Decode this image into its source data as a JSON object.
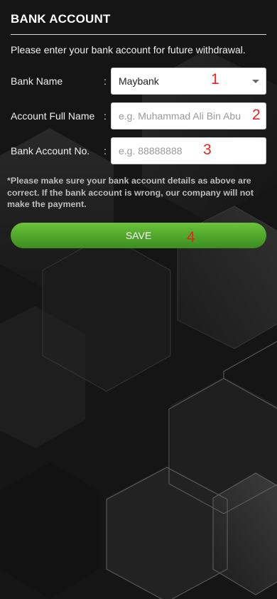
{
  "header": {
    "title": "BANK ACCOUNT",
    "intro": "Please enter your bank account for future withdrawal."
  },
  "form": {
    "bank_name": {
      "label": "Bank Name",
      "colon": ":",
      "selected": "Maybank",
      "marker": "1"
    },
    "full_name": {
      "label": "Account Full Name",
      "colon": ":",
      "value": "",
      "placeholder": "e.g. Muhammad Ali Bin Abu",
      "marker": "2"
    },
    "account_no": {
      "label": "Bank Account No.",
      "colon": ":",
      "value": "",
      "placeholder": "e.g. 88888888",
      "marker": "3"
    }
  },
  "notice": "*Please make sure your bank account details as above are correct. If the bank account is wrong, our company will not make the payment.",
  "save": {
    "label": "SAVE",
    "marker": "4"
  },
  "colors": {
    "background": "#161616",
    "accent_green": "#4ea52a",
    "marker_red": "#e5241f",
    "notice_text": "#bdbdbd"
  }
}
